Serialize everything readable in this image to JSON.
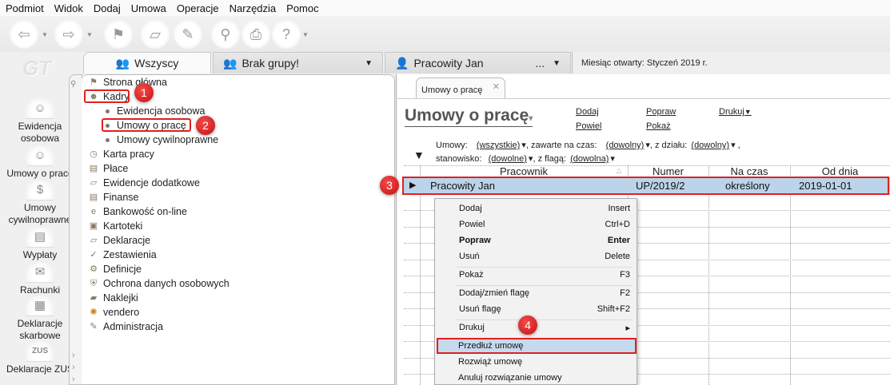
{
  "menu": [
    "Podmiot",
    "Widok",
    "Dodaj",
    "Umowa",
    "Operacje",
    "Narzędzia",
    "Pomoc"
  ],
  "logo": "GT",
  "group_tabs": {
    "all": "Wszyscy",
    "group": "Brak grupy!",
    "person": "Pracowity Jan",
    "person_more": "..."
  },
  "info": "Miesiąc otwarty:  Styczeń 2019 r.",
  "sidebar": [
    "Ewidencja osobowa",
    "Umowy o pracę",
    "Umowy cywilnoprawne",
    "Wypłaty",
    "Rachunki",
    "Deklaracje skarbowe",
    "Deklaracje ZUS"
  ],
  "sidebar_lines": [
    [
      "Ewidencja",
      "osobowa"
    ],
    [
      "Umowy o pracę"
    ],
    [
      "Umowy",
      "cywilnoprawne"
    ],
    [
      "Wypłaty"
    ],
    [
      "Rachunki"
    ],
    [
      "Deklaracje",
      "skarbowe"
    ],
    [
      "Deklaracje ZUS"
    ]
  ],
  "tree": {
    "items": [
      "Strona główna",
      "Kadry",
      "Karta pracy",
      "Płace",
      "Ewidencje dodatkowe",
      "Finanse",
      "Bankowość on-line",
      "Kartoteki",
      "Deklaracje",
      "Zestawienia",
      "Definicje",
      "Ochrona danych osobowych",
      "Naklejki",
      "vendero",
      "Administracja"
    ],
    "sub": [
      "Ewidencja osobowa",
      "Umowy o pracę",
      "Umowy cywilnoprawne"
    ]
  },
  "badges": [
    "1",
    "2",
    "3",
    "4"
  ],
  "doc_tab": "Umowy o pracę",
  "page_title": "Umowy o pracę",
  "actions": {
    "dodaj": "Dodaj",
    "powiel": "Powiel",
    "popraw": "Popraw",
    "pokaz": "Pokaż",
    "drukuj": "Drukuj"
  },
  "filters": {
    "umowy_label": "Umowy:",
    "umowy": "(wszystkie)",
    "czas_label": ", zawarte na czas:",
    "czas": "(dowolny)",
    "dzial_label": ", z działu:",
    "dzial": "(dowolny)",
    "stan_label": "stanowisko:",
    "stan": "(dowolne)",
    "flaga_label": ", z flagą:",
    "flaga": "(dowolna)"
  },
  "table": {
    "columns": [
      "Pracownik",
      "Numer",
      "Na czas",
      "Od dnia"
    ],
    "rows": [
      [
        "Pracowity Jan",
        "UP/2019/2",
        "określony",
        "2019-01-01"
      ]
    ]
  },
  "context_menu": [
    {
      "label": "Dodaj",
      "shortcut": "Insert"
    },
    {
      "label": "Powiel",
      "shortcut": "Ctrl+D"
    },
    {
      "label": "Popraw",
      "shortcut": "Enter"
    },
    {
      "label": "Usuń",
      "shortcut": "Delete"
    },
    {
      "label": "Pokaż",
      "shortcut": "F3"
    },
    {
      "label": "Dodaj/zmień flagę",
      "shortcut": "F2"
    },
    {
      "label": "Usuń flagę",
      "shortcut": "Shift+F2"
    },
    {
      "label": "Drukuj",
      "shortcut": "▸"
    },
    {
      "label": "Przedłuż umowę",
      "shortcut": ""
    },
    {
      "label": "Rozwiąż umowę",
      "shortcut": ""
    },
    {
      "label": "Anuluj rozwiązanie umowy",
      "shortcut": ""
    }
  ]
}
